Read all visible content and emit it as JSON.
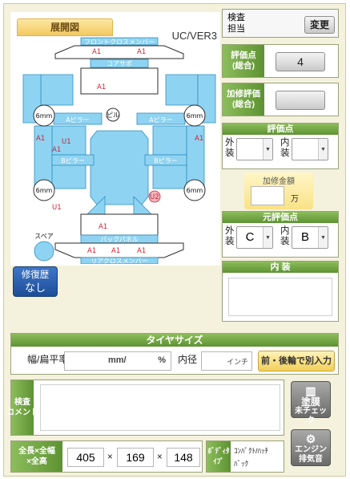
{
  "diagram": {
    "tab_label": "展開図",
    "version": "UC/VER3",
    "parts": {
      "front_cross_member": "フロントクロスメンバー",
      "core_support": "コアサポ",
      "a_pillar_left": "Aピラー",
      "a_pillar_right": "Aピラー",
      "b_pillar_left": "Bピラー",
      "b_pillar_right": "Bピラー",
      "back_panel": "バックパネル",
      "rear_cross_member": "リアクロスメンバー",
      "spare": "スペア",
      "center_label": "ピル"
    },
    "tires": [
      "6mm",
      "6mm",
      "6mm",
      "6mm"
    ],
    "marks": {
      "a1": "A1",
      "u1": "U1",
      "u2": "U2"
    }
  },
  "inspector": {
    "label": "検査\n担当",
    "change_button": "変更"
  },
  "score": {
    "label": "評価点\n(総合)",
    "value": "4"
  },
  "repair_score": {
    "label": "加修評価\n(総合)",
    "value": ""
  },
  "eval_points": {
    "title": "評価点",
    "exterior_label": "外\n装",
    "exterior_value": "",
    "interior_label": "内\n装",
    "interior_value": ""
  },
  "repair_amount": {
    "label": "加修金額",
    "value": "",
    "unit": "万"
  },
  "original_points": {
    "title": "元評価点",
    "exterior_label": "外\n装",
    "exterior_value": "C",
    "interior_label": "内\n装",
    "interior_value": "B"
  },
  "interior": {
    "title": "内 装",
    "value": ""
  },
  "repair_history": {
    "label_top": "修復歴",
    "label_bottom": "なし"
  },
  "tire": {
    "title": "タイヤサイズ",
    "width_label": "幅/扁平率",
    "width_value": "",
    "mm_unit": "mm/",
    "percent_unit": "%",
    "inner_label": "内径",
    "inner_value": "",
    "inch_unit": "インチ",
    "separate_button": "前・後輪で別入力"
  },
  "comment": {
    "label": "検査\nコメント",
    "value": ""
  },
  "paint_button": {
    "icon": "▥",
    "line1": "塗膜",
    "line2": "未チェック"
  },
  "engine_button": {
    "icon": "⚙",
    "line1": "エンジン",
    "line2": "排気音"
  },
  "dimensions": {
    "label": "全長×全幅\n×全高",
    "length": "405",
    "width": "169",
    "height": "148",
    "times": "×"
  },
  "body_type": {
    "label": "ﾎﾞﾃﾞｨﾀ\nｲﾌﾟ",
    "value": "ｺﾝﾊﾟｸﾄ/ﾊｯﾁ\nﾊﾞｯｸ"
  },
  "colors": {
    "green": "#6aa23b",
    "part_blue": "#8fd3f2",
    "mark_red": "#d02030",
    "tab_gold": "#f3c860"
  }
}
